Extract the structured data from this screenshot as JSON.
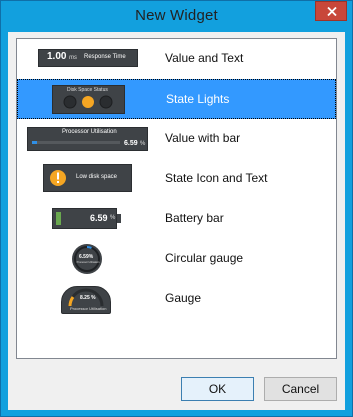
{
  "window": {
    "title": "New Widget"
  },
  "items": [
    {
      "label": "Value and Text",
      "thumb": {
        "value": "1.00",
        "unit": "ms",
        "text": "Response Time"
      }
    },
    {
      "label": "State Lights",
      "selected": true,
      "thumb": {
        "text": "Disk Space Status"
      }
    },
    {
      "label": "Value with bar",
      "thumb": {
        "title": "Processor Utilisation",
        "value": "6.59",
        "unit": "%"
      }
    },
    {
      "label": "State Icon and Text",
      "thumb": {
        "text": "Low disk space"
      }
    },
    {
      "label": "Battery bar",
      "thumb": {
        "value": "6.59",
        "unit": "%"
      }
    },
    {
      "label": "Circular gauge",
      "thumb": {
        "value": "6.59%",
        "text": "Processor Utilisation"
      }
    },
    {
      "label": "Gauge",
      "thumb": {
        "value": "8.25 %",
        "text": "Processor Utilisation"
      }
    }
  ],
  "buttons": {
    "ok": "OK",
    "cancel": "Cancel"
  },
  "colors": {
    "title_bar": "#12a0de",
    "selection": "#3399ff",
    "close": "#c8473a",
    "amber": "#f5a623",
    "blue_accent": "#2f8fe6",
    "green_accent": "#6aa84f"
  }
}
